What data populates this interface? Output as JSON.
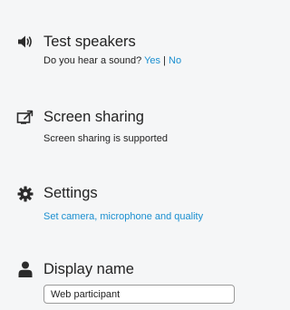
{
  "speakers": {
    "title": "Test speakers",
    "question": "Do you hear a sound?",
    "yes_label": "Yes",
    "separator": "|",
    "no_label": "No",
    "icon": "speaker-icon"
  },
  "screen_sharing": {
    "title": "Screen sharing",
    "status": "Screen sharing is supported",
    "icon": "screen-share-icon"
  },
  "settings": {
    "title": "Settings",
    "link_label": "Set camera, microphone and quality",
    "icon": "gear-icon"
  },
  "display_name": {
    "title": "Display name",
    "value": "Web participant",
    "icon": "user-icon"
  },
  "colors": {
    "link": "#1a8fd0",
    "background": "#f5f6f7"
  }
}
